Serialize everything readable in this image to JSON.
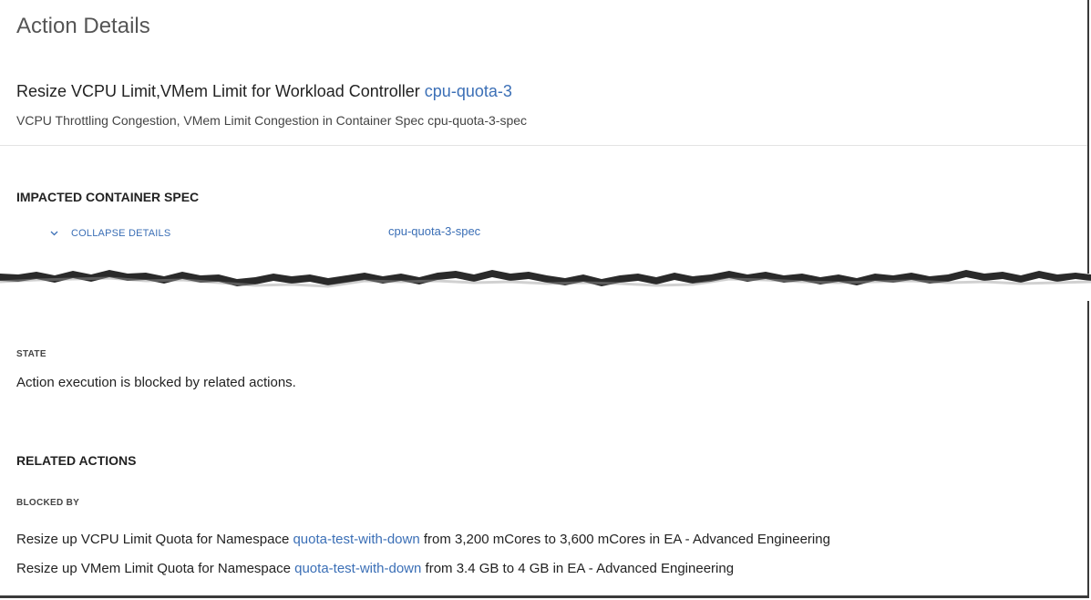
{
  "page": {
    "title": "Action Details"
  },
  "action": {
    "heading_prefix": "Resize VCPU Limit,VMem Limit for Workload Controller ",
    "heading_link": "cpu-quota-3",
    "subtitle": "VCPU Throttling Congestion, VMem Limit Congestion in Container Spec cpu-quota-3-spec"
  },
  "impacted": {
    "section_title": "IMPACTED CONTAINER SPEC",
    "collapse_label": "COLLAPSE DETAILS",
    "collapse_icon": "chevron-down-icon",
    "spec_link": "cpu-quota-3-spec"
  },
  "state": {
    "label": "STATE",
    "text": "Action execution is blocked by related actions."
  },
  "related": {
    "section_title": "RELATED ACTIONS",
    "blocked_by_label": "BLOCKED BY",
    "items": [
      {
        "prefix": "Resize up VCPU Limit Quota for Namespace ",
        "link": "quota-test-with-down",
        "suffix": " from 3,200 mCores to 3,600 mCores in EA - Advanced Engineering"
      },
      {
        "prefix": "Resize up VMem Limit Quota for Namespace ",
        "link": "quota-test-with-down",
        "suffix": " from 3.4 GB to 4 GB in EA - Advanced Engineering"
      }
    ]
  },
  "colors": {
    "link": "#3b6fb6",
    "text": "#222222",
    "border": "#3a3a3a"
  }
}
